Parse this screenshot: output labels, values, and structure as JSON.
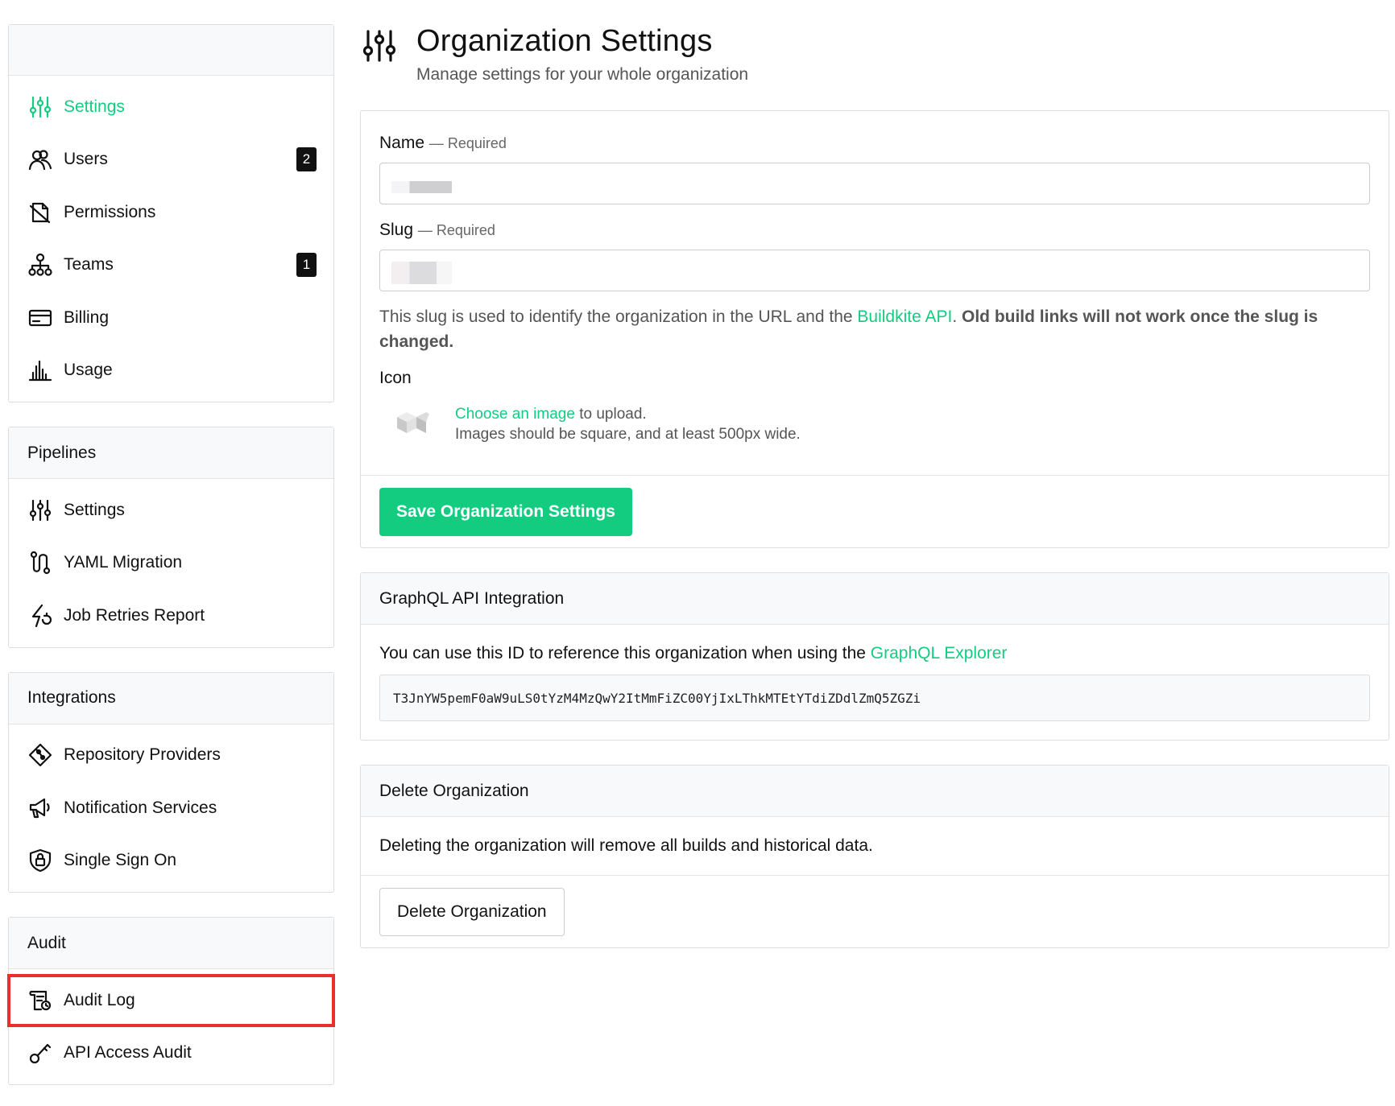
{
  "sidebar": {
    "org_items": [
      {
        "label": "Settings",
        "icon": "sliders-icon",
        "active": true
      },
      {
        "label": "Users",
        "icon": "users-icon",
        "badge": "2"
      },
      {
        "label": "Permissions",
        "icon": "permissions-icon"
      },
      {
        "label": "Teams",
        "icon": "teams-icon",
        "badge": "1"
      },
      {
        "label": "Billing",
        "icon": "billing-icon"
      },
      {
        "label": "Usage",
        "icon": "usage-chart-icon"
      }
    ],
    "pipelines": {
      "title": "Pipelines",
      "items": [
        {
          "label": "Settings",
          "icon": "sliders-icon"
        },
        {
          "label": "YAML Migration",
          "icon": "migration-icon"
        },
        {
          "label": "Job Retries Report",
          "icon": "retry-icon"
        }
      ]
    },
    "integrations": {
      "title": "Integrations",
      "items": [
        {
          "label": "Repository Providers",
          "icon": "git-icon"
        },
        {
          "label": "Notification Services",
          "icon": "megaphone-icon"
        },
        {
          "label": "Single Sign On",
          "icon": "shield-lock-icon"
        }
      ]
    },
    "audit": {
      "title": "Audit",
      "items": [
        {
          "label": "Audit Log",
          "icon": "audit-log-icon",
          "highlighted": true
        },
        {
          "label": "API Access Audit",
          "icon": "key-icon"
        }
      ]
    }
  },
  "header": {
    "title": "Organization Settings",
    "subtitle": "Manage settings for your whole organization",
    "icon": "sliders-icon"
  },
  "form": {
    "name_label": "Name",
    "slug_label": "Slug",
    "required_text": "— Required",
    "slug_hint_pre": "This slug is used to identify the organization in the URL and the ",
    "slug_hint_link": "Buildkite API",
    "slug_hint_post": ". ",
    "slug_hint_bold": "Old build links will not work once the slug is changed.",
    "icon_label": "Icon",
    "icon_choose_link": "Choose an image",
    "icon_choose_post": " to upload.",
    "icon_requirements": "Images should be square, and at least 500px wide.",
    "save_button": "Save Organization Settings"
  },
  "graphql": {
    "title": "GraphQL API Integration",
    "text_pre": "You can use this ID to reference this organization when using the ",
    "link": "GraphQL Explorer",
    "id_value": "T3JnYW5pemF0aW9uLS0tYzM4MzQwY2ItMmFiZC00YjIxLThkMTEtYTdiZDdlZmQ5ZGZi"
  },
  "delete": {
    "title": "Delete Organization",
    "text": "Deleting the organization will remove all builds and historical data.",
    "button": "Delete Organization"
  },
  "colors": {
    "accent": "#14cc80",
    "highlight_border": "#e8302a",
    "badge_bg": "#111111"
  }
}
